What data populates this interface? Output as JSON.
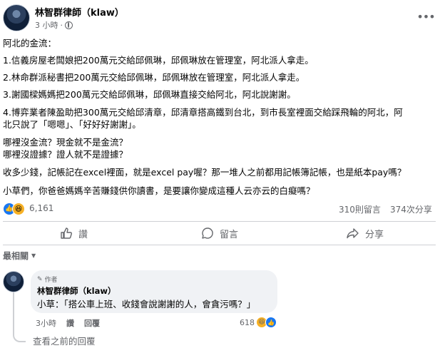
{
  "post": {
    "author": "林智群律師（klaw）",
    "time": "3 小時",
    "lines": [
      "阿北的金流：",
      "1.信義房屋老闆娘把200萬元交給邱佩琳，邱佩琳放在管理室，阿北派人拿走。",
      "2.林命群派秘書把200萬元交給邱佩琳，邱佩琳放在管理室，阿北派人拿走。",
      "3.謝國樑媽媽把200萬元交給邱佩琳，邱佩琳直接交給阿北，阿北說謝謝。",
      "4.博弈業者陳盈助把300萬元交給邱清章，邱清章搭高鐵到台北，到市長室裡面交給踩飛輪的阿北，阿",
      "北只說了「嗯嗯」、「好好好謝謝」。",
      "哪裡沒金流？現金就不是金流？",
      "哪裡沒證據？證人就不是證據？",
      "收多少錢，記帳記在excel裡面，就是excel pay喔？那一堆人之前都用記帳簿記帳，也是紙本pay嗎？",
      "小草們，你爸爸媽媽辛苦賺錢供你讀書，是要讓你變成這種人云亦云的白癡嗎？"
    ]
  },
  "stats": {
    "reactions": "6,161",
    "comments": "310則留言",
    "shares": "374次分享"
  },
  "actions": {
    "like": "讚",
    "comment": "留言",
    "share": "分享"
  },
  "sort_label": "最相關",
  "comment": {
    "author_tag": "作者",
    "author": "林智群律師（klaw）",
    "text": "小草：「搭公車上班、收錢會說謝謝的人，會貪污嗎？」",
    "time": "3小時",
    "like": "讚",
    "reply": "回覆",
    "reaction_count": "618"
  },
  "view_previous": "查看之前的回覆",
  "colors": {
    "accent": "#1877f2",
    "muted": "#65676b",
    "bubble": "#f0f2f5"
  }
}
